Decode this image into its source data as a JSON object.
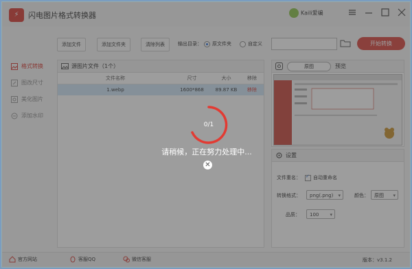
{
  "window": {
    "title": "闪电图片格式转换器",
    "logo_text": "⚡",
    "user": "Kaili爱编"
  },
  "toolbar": {
    "add_file": "添加文件",
    "add_folder": "添加文件夹",
    "clear_list": "清除列表",
    "output_dir_label": "输出目录：",
    "radio_source": "原文件夹",
    "radio_custom": "自定义",
    "output_path": "",
    "start": "开始转换"
  },
  "sidebar": {
    "items": [
      {
        "label": "格式转换",
        "icon": "image-icon",
        "active": true
      },
      {
        "label": "图改尺寸",
        "icon": "resize-icon",
        "active": false
      },
      {
        "label": "美化图片",
        "icon": "beautify-icon",
        "active": false
      },
      {
        "label": "添加水印",
        "icon": "watermark-icon",
        "active": false
      }
    ]
  },
  "filelist": {
    "header": "源图片文件（1个）",
    "columns": [
      "文件名称",
      "尺寸",
      "大小",
      "移除"
    ],
    "rows": [
      {
        "name": "1.webp",
        "dims": "1600*868",
        "size": "89.87 KB",
        "remove": "移除"
      }
    ]
  },
  "preview": {
    "select_value": "原图",
    "label": "预览"
  },
  "settings": {
    "header": "设置",
    "file_rename_label": "文件重名：",
    "auto_rename": "自动重命名",
    "format_label": "转换格式：",
    "format_value": "png(.png)",
    "color_label": "颜色：",
    "color_value": "原图",
    "quality_label": "品质：",
    "quality_value": "100"
  },
  "statusbar": {
    "website": "官方网站",
    "qq": "客服QQ",
    "wechat": "微信客服",
    "version": "版本：v3.1.2"
  },
  "overlay": {
    "progress": "0/1",
    "progress_fraction": 0,
    "message": "请稍候，正在努力处理中...",
    "close_icon_glyph": "✕"
  },
  "colors": {
    "accent": "#d63a32",
    "link": "#2a6fd6"
  }
}
